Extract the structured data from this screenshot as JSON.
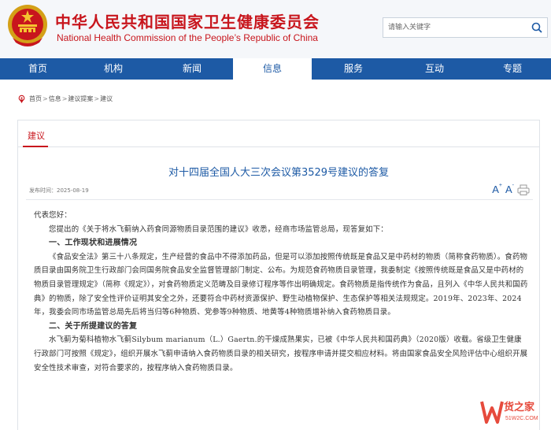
{
  "header": {
    "title_cn": "中华人民共和国国家卫生健康委员会",
    "title_en": "National Health Commission of the People’s Republic of China",
    "emblem_icon": "national-emblem-icon",
    "search_placeholder": "请输入关键字",
    "search_icon": "search-icon",
    "brand_color": "#c8161d"
  },
  "nav": {
    "color": "#1d5aa5",
    "items": [
      {
        "label": "首页",
        "active": false
      },
      {
        "label": "机构",
        "active": false
      },
      {
        "label": "新闻",
        "active": false
      },
      {
        "label": "信息",
        "active": true
      },
      {
        "label": "服务",
        "active": false
      },
      {
        "label": "互动",
        "active": false
      },
      {
        "label": "专题",
        "active": false
      }
    ]
  },
  "breadcrumb": {
    "home_icon": "home-icon",
    "items": [
      "首页",
      "信息",
      "建议提案",
      "建议"
    ],
    "separator": ">"
  },
  "panel": {
    "tab_label": "建议"
  },
  "article": {
    "title": "对十四届全国人大三次会议第3529号建议的答复",
    "meta_label": "发布时间：",
    "date": "2025-08-19",
    "font_large": "A",
    "font_small": "A",
    "font_plus": "+",
    "font_minus": "-",
    "print_icon": "print-icon",
    "body": {
      "greeting": "代表您好：",
      "intro": "您提出的《关于将水飞蓟纳入药食同源物质目录范围的建议》收悉，经商市场监管总局，现答复如下：",
      "h1": "一、工作现状和进展情况",
      "p1": "《食品安全法》第三十八条规定，生产经营的食品中不得添加药品，但是可以添加按照传统既是食品又是中药材的物质（简称食药物质）。食药物质目录由国务院卫生行政部门会同国务院食品安全监督管理部门制定、公布。为规范食药物质目录管理，我委制定《按照传统既是食品又是中药材的物质目录管理规定》（简称《规定》），对食药物质定义范畴及目录修订程序等作出明确规定。食药物质是指传统作为食品，且列入《中华人民共和国药典》的物质，除了安全性评价证明其安全之外，还要符合中药材资源保护、野生动植物保护、生态保护等相关法规规定。2019年、2023年、2024年，我委会同市场监管总局先后将当归等6种物质、党参等9种物质、地黄等4种物质增补纳入食药物质目录。",
      "h2": "二、关于所提建议的答复",
      "p2": "水飞蓟为菊科植物水飞蓟Silybum marianum（L.）Gaertn.的干燥成熟果实，已被《中华人民共和国药典》（2020版）收载。省级卫生健康行政部门可按照《规定》，组织开展水飞蓟申请纳入食药物质目录的相关研究，按程序申请并提交相应材料。将由国家食品安全风险评估中心组织开展安全性技术审查，对符合要求的，按程序纳入食药物质目录。"
    }
  },
  "watermark": {
    "text": "货之家",
    "sub": "51W2C.COM",
    "color": "#e64a3c"
  }
}
